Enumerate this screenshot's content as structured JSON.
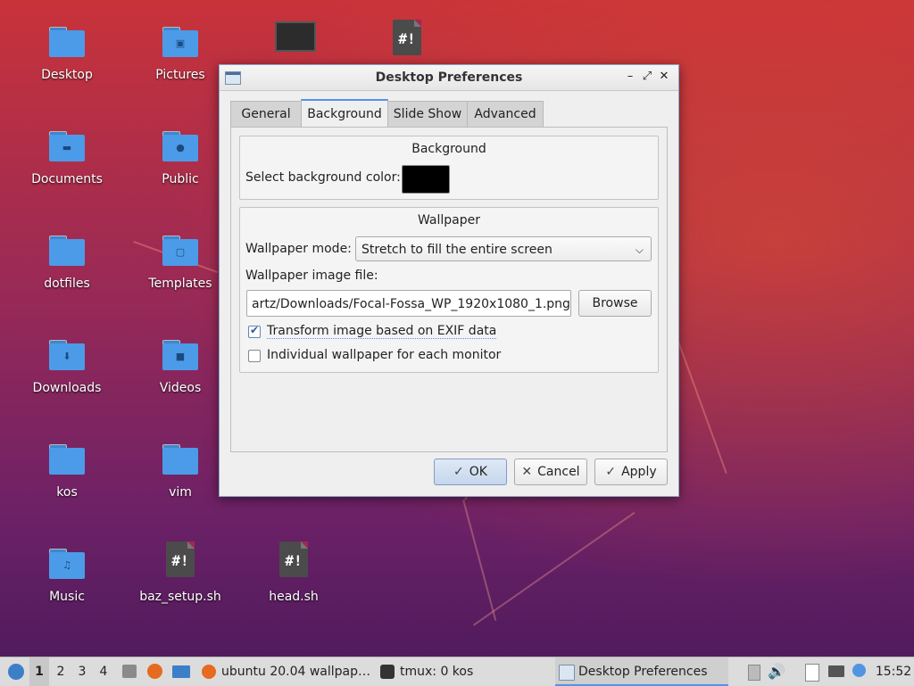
{
  "desktop": {
    "icons": [
      {
        "label": "Desktop",
        "kind": "folder",
        "emblem": ""
      },
      {
        "label": "Pictures",
        "kind": "folder",
        "emblem": "▣"
      },
      {
        "label": "",
        "kind": "monitor",
        "emblem": ""
      },
      {
        "label": "",
        "kind": "script",
        "emblem": "#!"
      },
      {
        "label": "Documents",
        "kind": "folder",
        "emblem": "▬"
      },
      {
        "label": "Public",
        "kind": "folder",
        "emblem": "●"
      },
      {
        "label": "dotfiles",
        "kind": "folder",
        "emblem": ""
      },
      {
        "label": "Templates",
        "kind": "folder",
        "emblem": "▢"
      },
      {
        "label": "Downloads",
        "kind": "folder",
        "emblem": "⬇"
      },
      {
        "label": "Videos",
        "kind": "folder",
        "emblem": "■"
      },
      {
        "label": "kos",
        "kind": "folder",
        "emblem": ""
      },
      {
        "label": "vim",
        "kind": "folder",
        "emblem": ""
      },
      {
        "label": "Music",
        "kind": "folder",
        "emblem": "♫"
      },
      {
        "label": "baz_setup.sh",
        "kind": "script",
        "emblem": "#!"
      },
      {
        "label": "head.sh",
        "kind": "script",
        "emblem": "#!"
      }
    ]
  },
  "dialog": {
    "title": "Desktop Preferences",
    "tabs": [
      "General",
      "Background",
      "Slide Show",
      "Advanced"
    ],
    "active_tab": "Background",
    "background_group": {
      "title": "Background",
      "color_label": "Select background color:",
      "color": "#000000"
    },
    "wallpaper_group": {
      "title": "Wallpaper",
      "mode_label": "Wallpaper mode:",
      "mode_value": "Stretch to fill the entire screen",
      "file_label": "Wallpaper image file:",
      "file_value": "artz/Downloads/Focal-Fossa_WP_1920x1080_1.png",
      "browse_label": "Browse",
      "exif_label": "Transform image based on EXIF data",
      "exif_checked": true,
      "per_monitor_label": "Individual wallpaper for each monitor",
      "per_monitor_checked": false
    },
    "buttons": {
      "ok": "OK",
      "cancel": "Cancel",
      "apply": "Apply"
    }
  },
  "taskbar": {
    "workspaces": [
      "1",
      "2",
      "3",
      "4"
    ],
    "active_workspace": "1",
    "tasks": [
      {
        "label": "ubuntu 20.04 wallpap…",
        "icon": "firefox-icon"
      },
      {
        "label": "tmux: 0 kos",
        "icon": "terminal-icon"
      },
      {
        "label": "Desktop Preferences",
        "icon": "window-icon"
      }
    ],
    "clock": "15:52"
  },
  "colors": {
    "accent": "#5294e2",
    "folder": "#4c9be8"
  }
}
